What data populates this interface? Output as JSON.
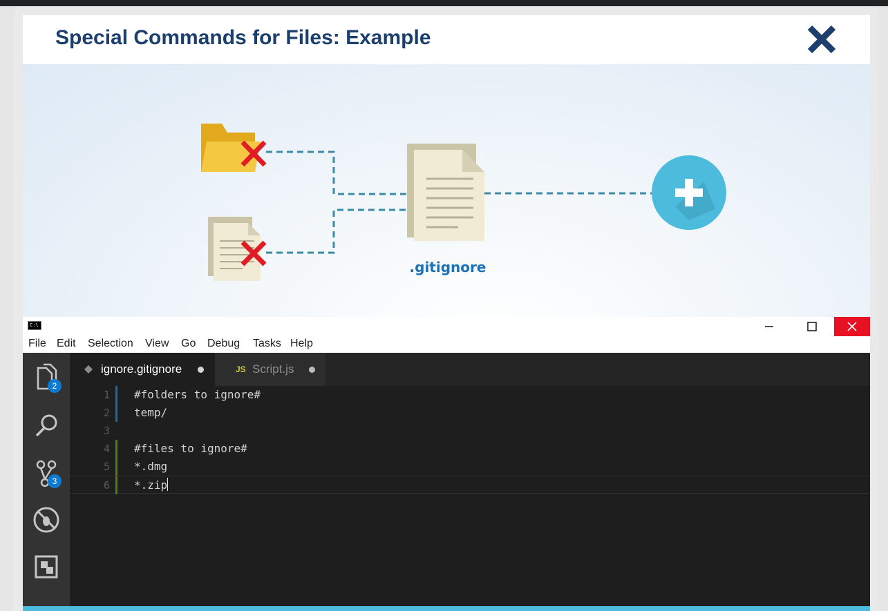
{
  "header": {
    "title": "Special Commands for Files: Example",
    "close_icon": "close-x-icon"
  },
  "diagram": {
    "file_label": ".gitignore",
    "icons": [
      "folder-icon",
      "excluded-x-icon",
      "document-icon",
      "gitignore-file-icon",
      "add-plus-icon"
    ],
    "colors": {
      "connector": "#3d8aa6",
      "cross": "#e01d24",
      "plus_circle": "#4dbbdc",
      "label": "#1a72b8"
    }
  },
  "window": {
    "menu": [
      "File",
      "Edit",
      "Selection",
      "View",
      "Go",
      "Debug",
      "Tasks",
      "Help"
    ]
  },
  "activity_bar": {
    "items": [
      {
        "icon": "explorer-files-icon",
        "badge": "2"
      },
      {
        "icon": "search-icon"
      },
      {
        "icon": "source-control-icon",
        "badge": "3"
      },
      {
        "icon": "debug-icon"
      },
      {
        "icon": "extensions-icon"
      }
    ]
  },
  "tabs": [
    {
      "label": "ignore.gitignore",
      "icon": "gitignore-diamond-icon",
      "modified": true
    },
    {
      "label": "Script.js",
      "icon_text": "JS",
      "modified": true
    }
  ],
  "editor": {
    "lines": [
      {
        "number": "1",
        "text": "#folders to ignore#"
      },
      {
        "number": "2",
        "text": "temp/"
      },
      {
        "number": "3",
        "text": ""
      },
      {
        "number": "4",
        "text": "#files to ignore#"
      },
      {
        "number": "5",
        "text": "*.dmg"
      },
      {
        "number": "6",
        "text": "*.zip"
      }
    ]
  }
}
